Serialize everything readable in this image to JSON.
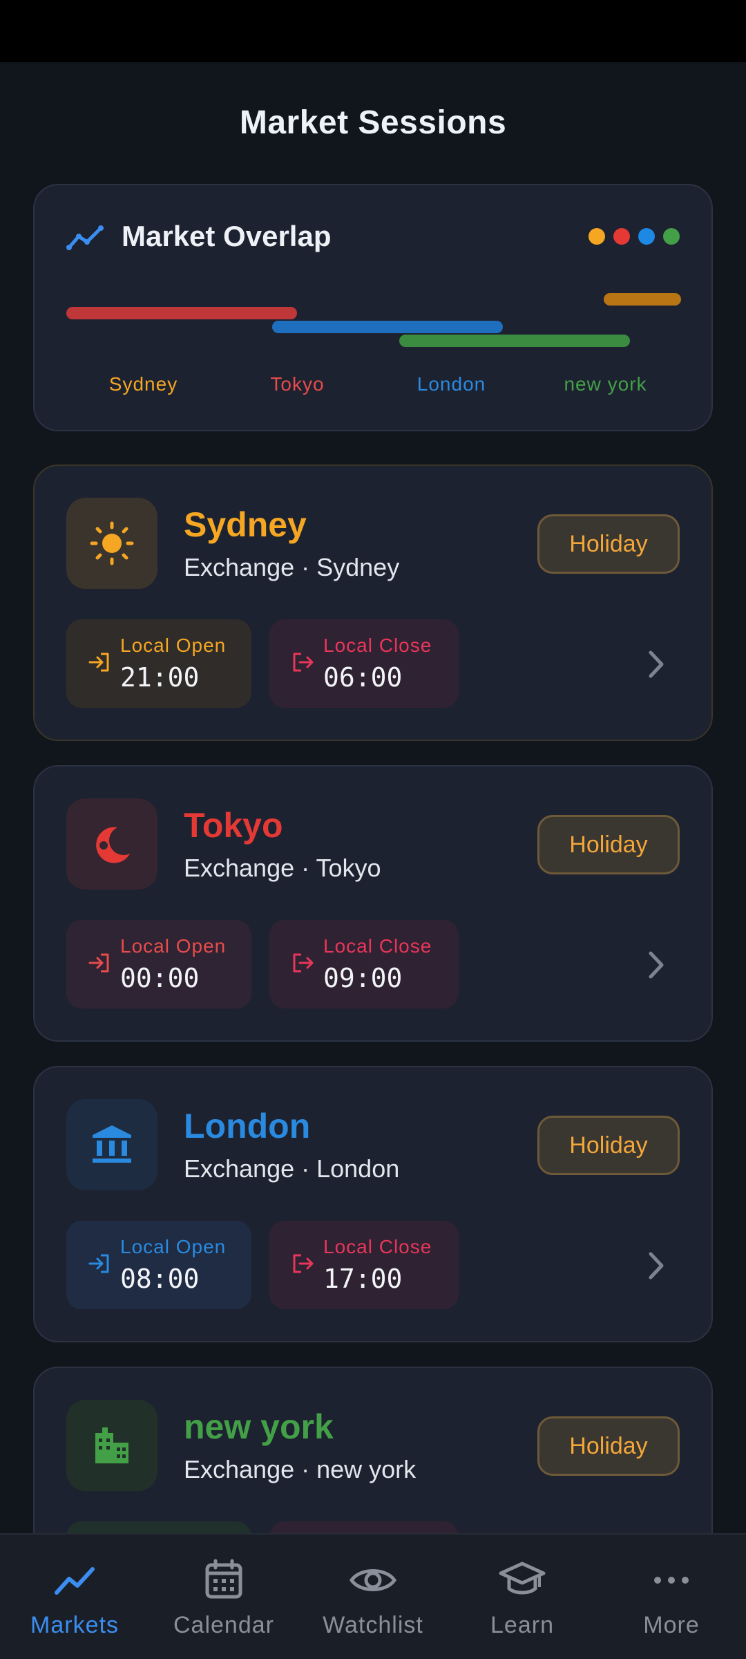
{
  "page": {
    "title": "Market Sessions"
  },
  "overlap": {
    "title": "Market Overlap",
    "icon": "trending-line-icon",
    "dot_colors": [
      "#f5a623",
      "#e53935",
      "#1e88e5",
      "#43a047"
    ],
    "labels": [
      {
        "text": "Sydney",
        "color": "#f5a623"
      },
      {
        "text": "Tokyo",
        "color": "#e84b4b"
      },
      {
        "text": "London",
        "color": "#2a8ae0"
      },
      {
        "text": "new york",
        "color": "#43a047"
      }
    ]
  },
  "markets": [
    {
      "name": "Sydney",
      "subtitle": "Exchange · Sydney",
      "badge": "Holiday",
      "icon": "sun-icon",
      "color": "#f5a623",
      "open_label": "Local Open",
      "open_time": "21:00",
      "close_label": "Local Close",
      "close_time": "06:00"
    },
    {
      "name": "Tokyo",
      "subtitle": "Exchange · Tokyo",
      "badge": "Holiday",
      "icon": "moon-icon",
      "color": "#e53935",
      "open_label": "Local Open",
      "open_time": "00:00",
      "close_label": "Local Close",
      "close_time": "09:00"
    },
    {
      "name": "London",
      "subtitle": "Exchange · London",
      "badge": "Holiday",
      "icon": "bank-icon",
      "color": "#2a8ae0",
      "open_label": "Local Open",
      "open_time": "08:00",
      "close_label": "Local Close",
      "close_time": "17:00"
    },
    {
      "name": "new york",
      "subtitle": "Exchange · new york",
      "badge": "Holiday",
      "icon": "city-buildings-icon",
      "color": "#43a047"
    }
  ],
  "nav": [
    {
      "label": "Markets",
      "icon": "trending-line-icon",
      "active": true
    },
    {
      "label": "Calendar",
      "icon": "calendar-icon"
    },
    {
      "label": "Watchlist",
      "icon": "eye-icon"
    },
    {
      "label": "Learn",
      "icon": "graduation-cap-icon"
    },
    {
      "label": "More",
      "icon": "more-dots-icon"
    }
  ]
}
